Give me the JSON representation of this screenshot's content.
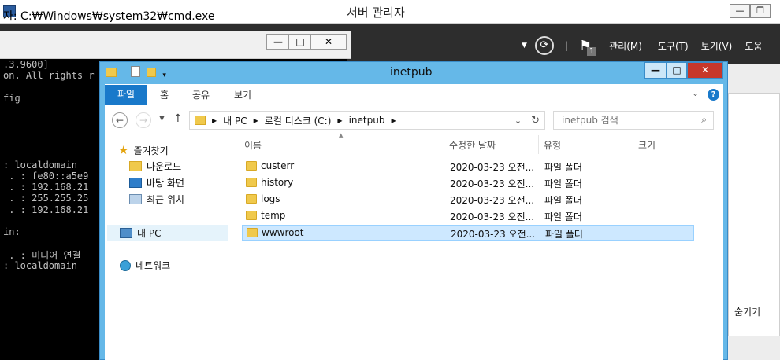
{
  "server_manager": {
    "title": "서버 관리자",
    "menus": [
      "관리(M)",
      "도구(T)",
      "보기(V)",
      "도움"
    ],
    "notification_count": "1",
    "side_text": "숨기기"
  },
  "cmd": {
    "title": "자: C:₩Windows₩system32₩cmd.exe",
    "lines": [
      ".3.9600]",
      "on. All rights r",
      "",
      "fig",
      "",
      "",
      "",
      "",
      "",
      ": localdomain",
      " . : fe80::a5e9",
      " . : 192.168.21",
      " . : 255.255.25",
      " . : 192.168.21",
      "",
      "in:",
      "",
      " . : 미디어 연결",
      ": localdomain"
    ]
  },
  "explorer": {
    "title": "inetpub",
    "ribbon_tabs": [
      "파일",
      "홈",
      "공유",
      "보기"
    ],
    "breadcrumb": [
      "내 PC",
      "로컬 디스크 (C:)",
      "inetpub"
    ],
    "search_placeholder": "inetpub 검색",
    "nav": {
      "favorites": "즐겨찾기",
      "downloads": "다운로드",
      "desktop": "바탕 화면",
      "recent": "최근 위치",
      "this_pc": "내 PC",
      "network": "네트워크"
    },
    "columns": [
      "이름",
      "수정한 날짜",
      "유형",
      "크기"
    ],
    "files": [
      {
        "name": "custerr",
        "date": "2020-03-23 오전...",
        "type": "파일 폴더"
      },
      {
        "name": "history",
        "date": "2020-03-23 오전...",
        "type": "파일 폴더"
      },
      {
        "name": "logs",
        "date": "2020-03-23 오전...",
        "type": "파일 폴더"
      },
      {
        "name": "temp",
        "date": "2020-03-23 오전...",
        "type": "파일 폴더"
      },
      {
        "name": "wwwroot",
        "date": "2020-03-23 오전...",
        "type": "파일 폴더"
      }
    ],
    "selected_file": "wwwroot"
  }
}
